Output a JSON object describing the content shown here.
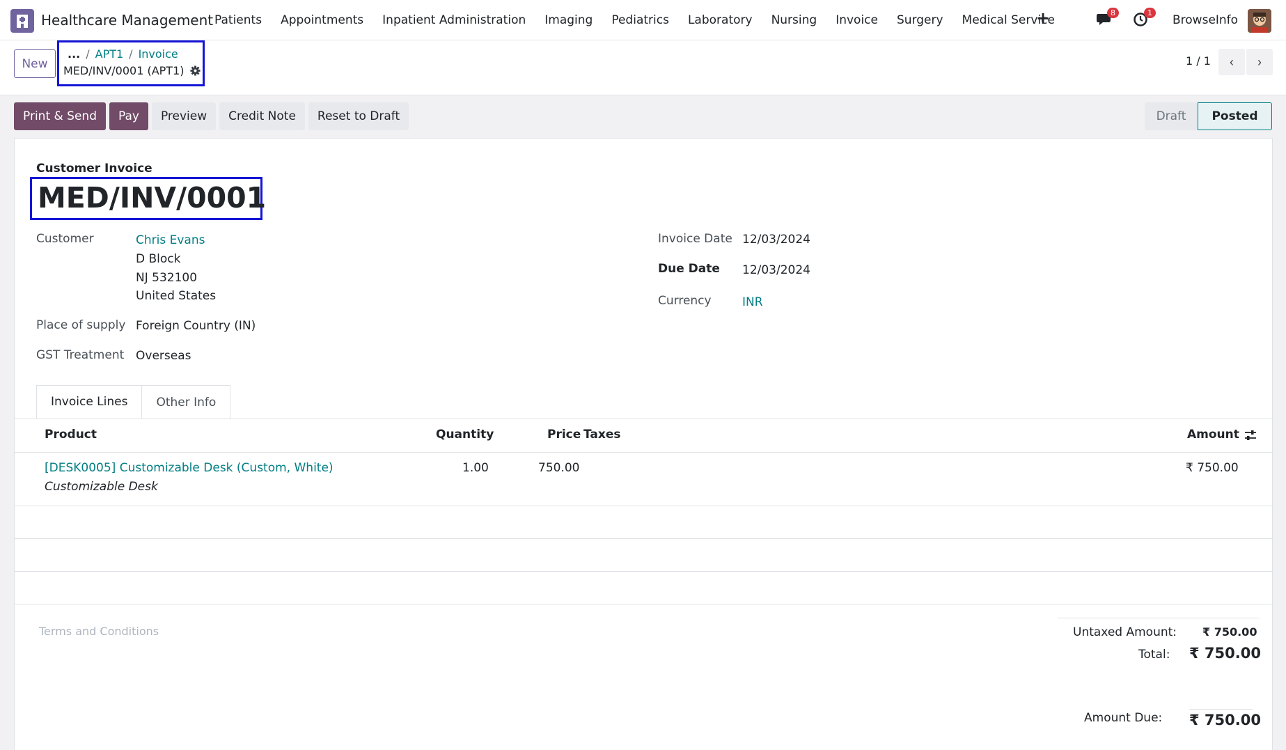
{
  "navbar": {
    "app_name": "Healthcare Management",
    "menu": [
      "Patients",
      "Appointments",
      "Inpatient Administration",
      "Imaging",
      "Pediatrics",
      "Laboratory",
      "Nursing",
      "Invoice",
      "Surgery",
      "Medical Service"
    ],
    "plus": "+",
    "messages_count": "8",
    "activities_count": "1",
    "company": "BrowseInfo"
  },
  "control_panel": {
    "new_label": "New",
    "breadcrumb_dots": "...",
    "breadcrumb": [
      "APT1",
      "Invoice"
    ],
    "record_title": "MED/INV/0001 (APT1)",
    "pager": "1 / 1"
  },
  "actions": {
    "print_send": "Print & Send",
    "pay": "Pay",
    "preview": "Preview",
    "credit_note": "Credit Note",
    "reset_draft": "Reset to Draft"
  },
  "status": {
    "draft": "Draft",
    "posted": "Posted"
  },
  "invoice": {
    "doc_type": "Customer Invoice",
    "number": "MED/INV/0001",
    "customer_label": "Customer",
    "customer_name": "Chris Evans",
    "address": [
      "D Block",
      "NJ 532100",
      "United States"
    ],
    "place_label": "Place of supply",
    "place_value": "Foreign Country (IN)",
    "gst_label": "GST Treatment",
    "gst_value": "Overseas",
    "invoice_date_label": "Invoice Date",
    "invoice_date": "12/03/2024",
    "due_date_label": "Due Date",
    "due_date": "12/03/2024",
    "currency_label": "Currency",
    "currency": "INR"
  },
  "tabs": [
    "Invoice Lines",
    "Other Info"
  ],
  "lines": {
    "headers": {
      "product": "Product",
      "quantity": "Quantity",
      "price": "Price",
      "taxes": "Taxes",
      "amount": "Amount"
    },
    "rows": [
      {
        "product": "[DESK0005] Customizable Desk (Custom, White)",
        "description": "Customizable Desk",
        "quantity": "1.00",
        "price": "750.00",
        "amount": "₹ 750.00"
      }
    ]
  },
  "footer": {
    "terms_placeholder": "Terms and Conditions",
    "untaxed_label": "Untaxed Amount:",
    "untaxed_value": "₹ 750.00",
    "total_label": "Total:",
    "total_value": "₹ 750.00",
    "due_label": "Amount Due:",
    "due_value": "₹ 750.00"
  },
  "colors": {
    "brand": "#714b67",
    "link": "#017e84",
    "highlight_box": "#1515d6"
  }
}
